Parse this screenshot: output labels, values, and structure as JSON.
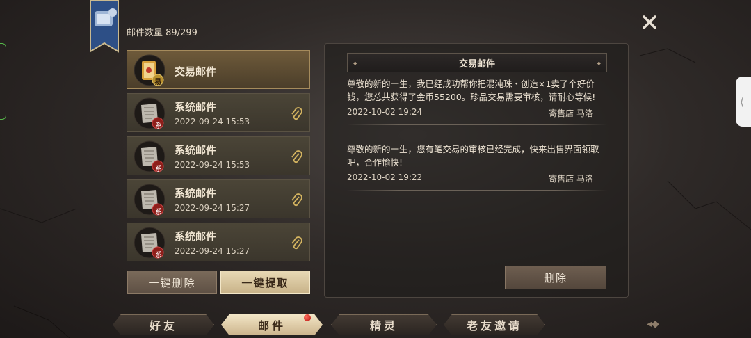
{
  "header": {
    "mail_count_label": "邮件数量",
    "mail_count_value": "89/299"
  },
  "close_icon": "close-icon",
  "mail_list": [
    {
      "title": "交易邮件",
      "date": "",
      "badge": "易",
      "selected": true,
      "attachment": false
    },
    {
      "title": "系统邮件",
      "date": "2022-09-24 15:53",
      "badge": "系",
      "selected": false,
      "attachment": true
    },
    {
      "title": "系统邮件",
      "date": "2022-09-24 15:53",
      "badge": "系",
      "selected": false,
      "attachment": true
    },
    {
      "title": "系统邮件",
      "date": "2022-09-24 15:27",
      "badge": "系",
      "selected": false,
      "attachment": true
    },
    {
      "title": "系统邮件",
      "date": "2022-09-24 15:27",
      "badge": "系",
      "selected": false,
      "attachment": true
    }
  ],
  "list_actions": {
    "delete_all": "一键删除",
    "collect_all": "一键提取"
  },
  "detail": {
    "title": "交易邮件",
    "messages": [
      {
        "text": "尊敬的新的一生，我已经成功帮你把混沌珠・创造×1卖了个好价钱，您总共获得了金币55200。珍品交易需要审核，请耐心等候!",
        "date": "2022-10-02 19:24",
        "sender": "寄售店 马洛"
      },
      {
        "text": "尊敬的新的一生，您有笔交易的审核已经完成，快来出售界面领取吧，合作愉快!",
        "date": "2022-10-02 19:22",
        "sender": "寄售店 马洛"
      }
    ],
    "delete_label": "删除"
  },
  "tabs": [
    {
      "label": "好友",
      "active": false
    },
    {
      "label": "邮件",
      "active": true
    },
    {
      "label": "精灵",
      "active": false
    },
    {
      "label": "老友邀请",
      "active": false
    }
  ],
  "colors": {
    "accent_gold": "#c8b288",
    "notify_red": "#b3130e"
  }
}
